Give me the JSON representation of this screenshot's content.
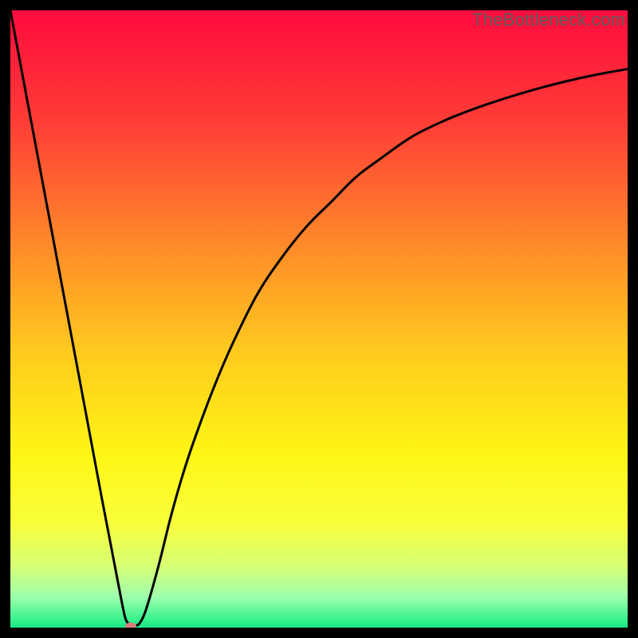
{
  "watermark": "TheBottleneck.com",
  "chart_data": {
    "type": "line",
    "title": "",
    "xlabel": "",
    "ylabel": "",
    "xlim": [
      0,
      100
    ],
    "ylim": [
      0,
      100
    ],
    "grid": false,
    "series": [
      {
        "name": "bottleneck-curve",
        "x": [
          0,
          3,
          6,
          9,
          12,
          15,
          17.5,
          18.5,
          19,
          19.5,
          20,
          20.5,
          21,
          22,
          24,
          26,
          28,
          30,
          33,
          36,
          40,
          44,
          48,
          52,
          56,
          60,
          65,
          70,
          75,
          80,
          85,
          90,
          95,
          100
        ],
        "y": [
          100,
          84,
          68,
          52,
          36,
          20,
          7,
          2,
          0.8,
          0.4,
          0.3,
          0.4,
          0.8,
          3,
          10,
          18,
          25,
          31,
          39,
          46,
          54,
          60,
          65,
          69,
          73,
          76,
          79.5,
          82,
          84,
          85.7,
          87.2,
          88.5,
          89.6,
          90.5
        ]
      }
    ],
    "marker": {
      "x": 19.5,
      "y": 0.3,
      "color": "#d97f7a",
      "rx": 7,
      "ry": 4
    },
    "background_gradient": {
      "stops": [
        {
          "offset": 0.0,
          "color": "#ff0b3e"
        },
        {
          "offset": 0.18,
          "color": "#ff3d36"
        },
        {
          "offset": 0.38,
          "color": "#ff8a2a"
        },
        {
          "offset": 0.55,
          "color": "#ffc91e"
        },
        {
          "offset": 0.72,
          "color": "#fff615"
        },
        {
          "offset": 0.83,
          "color": "#f8ff3a"
        },
        {
          "offset": 0.9,
          "color": "#d7ff74"
        },
        {
          "offset": 0.95,
          "color": "#9effac"
        },
        {
          "offset": 0.985,
          "color": "#3cf38f"
        },
        {
          "offset": 1.0,
          "color": "#18e884"
        }
      ]
    }
  }
}
